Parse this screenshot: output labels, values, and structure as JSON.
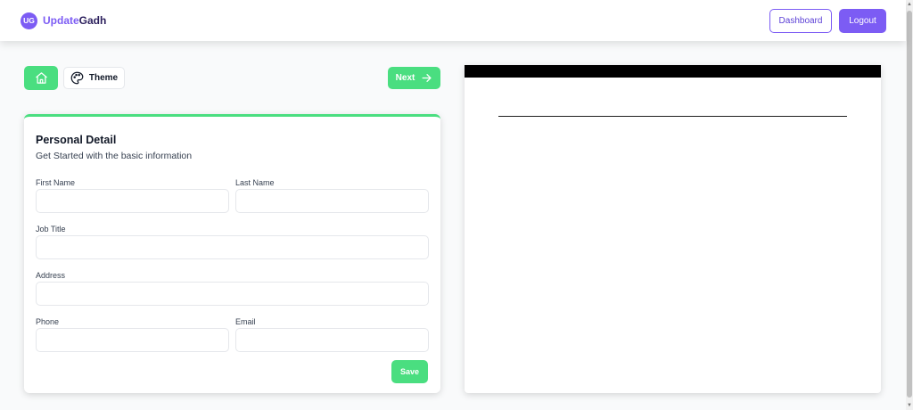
{
  "header": {
    "logo_initials": "UG",
    "brand_part1": "Update",
    "brand_part2": "Gadh",
    "dashboard_label": "Dashboard",
    "logout_label": "Logout"
  },
  "toolbar": {
    "theme_label": "Theme",
    "next_label": "Next"
  },
  "form": {
    "title": "Personal Detail",
    "subtitle": "Get Started with the basic information",
    "fields": {
      "first_name": {
        "label": "First Name",
        "value": ""
      },
      "last_name": {
        "label": "Last Name",
        "value": ""
      },
      "job_title": {
        "label": "Job Title",
        "value": ""
      },
      "address": {
        "label": "Address",
        "value": ""
      },
      "phone": {
        "label": "Phone",
        "value": ""
      },
      "email": {
        "label": "Email",
        "value": ""
      }
    },
    "save_label": "Save"
  },
  "colors": {
    "accent_purple": "#7c5cf4",
    "accent_green": "#4ade80"
  },
  "icons": {
    "home": "home-icon",
    "theme": "palette-icon",
    "next": "arrow-right-icon"
  }
}
